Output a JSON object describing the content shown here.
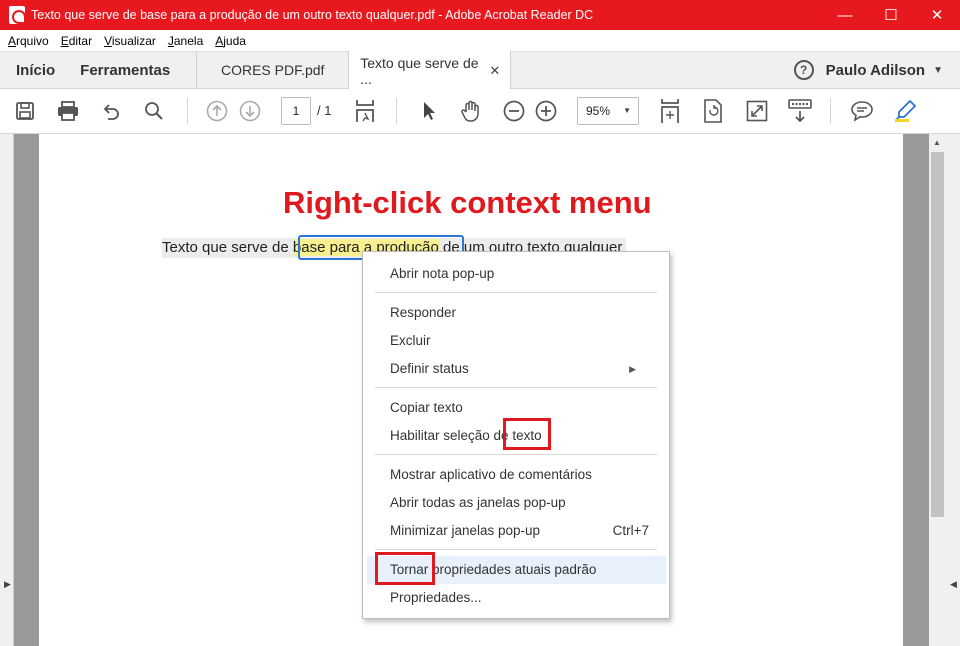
{
  "window": {
    "title": "Texto que serve de base para a produção de um outro texto qualquer.pdf - Adobe Acrobat Reader DC",
    "minimize_glyph": "—",
    "maximize_glyph": "☐",
    "close_glyph": "✕"
  },
  "menubar": {
    "items": [
      {
        "first": "A",
        "rest": "rquivo"
      },
      {
        "first": "E",
        "rest": "ditar"
      },
      {
        "first": "V",
        "rest": "isualizar"
      },
      {
        "first": "J",
        "rest": "anela"
      },
      {
        "first": "A",
        "rest": "juda"
      }
    ]
  },
  "tabs": {
    "home": "Início",
    "tools": "Ferramentas",
    "doc1": "CORES PDF.pdf",
    "doc2": "Texto que serve de ...",
    "close": "✕"
  },
  "account": {
    "help": "?",
    "user": "Paulo Adilson",
    "caret": "▼"
  },
  "toolbar": {
    "page_current": "1",
    "page_total": "/ 1",
    "zoom": "95%",
    "zoom_caret": "▼",
    "icons": [
      "save-icon",
      "print-icon",
      "undo-icon",
      "search-icon",
      "page-up-icon",
      "page-down-icon",
      "fit-page-icon",
      "select-tool-icon",
      "hand-tool-icon",
      "zoom-out-icon",
      "zoom-in-icon",
      "scroll-mode-icon",
      "rotate-icon",
      "fullscreen-icon",
      "read-mode-icon",
      "comment-icon",
      "highlight-pen-icon"
    ]
  },
  "document": {
    "annotation_title": "Right-click context menu",
    "text_before": "Texto que serve de ",
    "text_highlight": "base para a produção",
    "text_after": " de um outro texto qualquer"
  },
  "context_menu": {
    "open_note": "Abrir nota pop-up",
    "reply": "Responder",
    "delete": "Excluir",
    "set_status": "Definir status",
    "submenu_arrow": "▶",
    "copy_text": "Copiar texto",
    "enable_selection": "Habilitar seleção de texto",
    "show_comments_app": "Mostrar aplicativo de comentários",
    "open_all_popups": "Abrir todas as janelas pop-up",
    "minimize_popups": "Minimizar janelas pop-up",
    "minimize_shortcut": "Ctrl+7",
    "make_default": "Tornar propriedades atuais padrão",
    "properties": "Propriedades..."
  },
  "colors": {
    "titlebar": "#e8181f",
    "annotation_red": "#e0191f",
    "highlight": "#f8ef8f",
    "selection_blue": "#2a78d6"
  }
}
